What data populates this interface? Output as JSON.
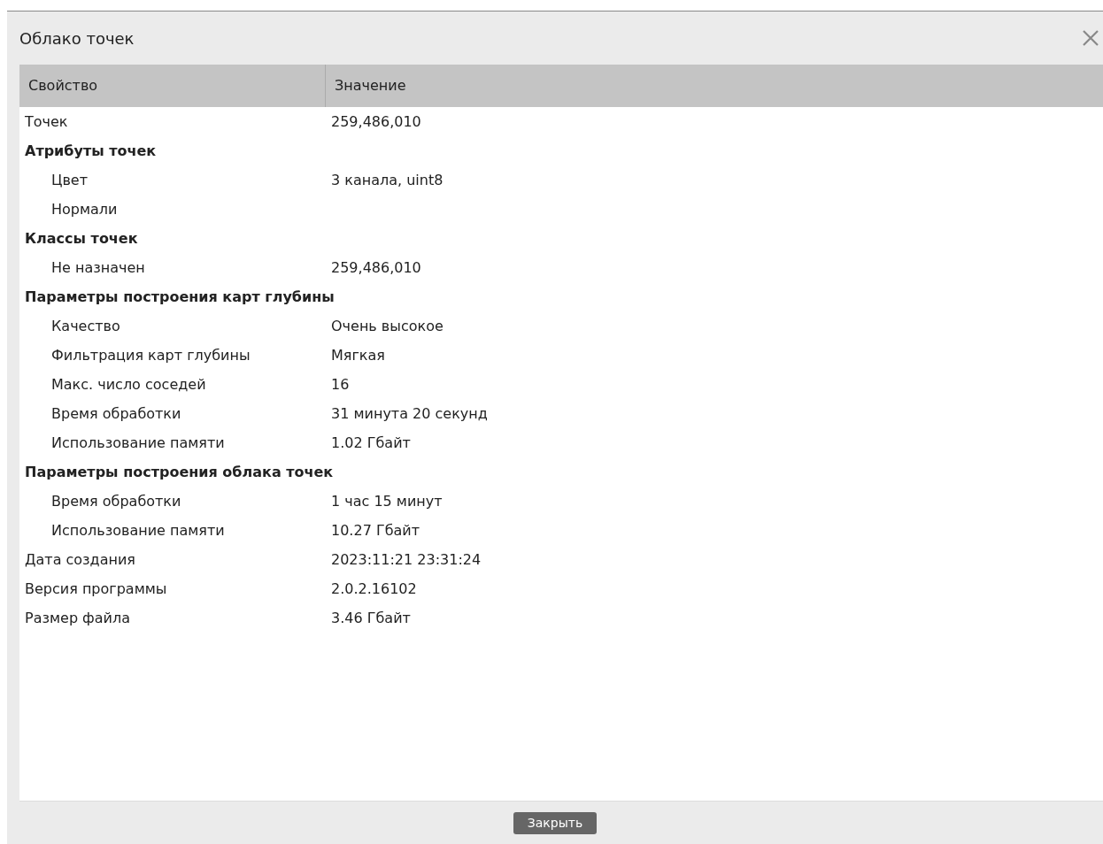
{
  "window": {
    "title": "Облако точек"
  },
  "table": {
    "columns": [
      "Свойство",
      "Значение"
    ],
    "rows": [
      {
        "kind": "property",
        "name": "Точек",
        "value": "259,486,010"
      },
      {
        "kind": "section",
        "name": "Атрибуты точек",
        "children": [
          {
            "kind": "property",
            "name": "Цвет",
            "value": "3 канала, uint8"
          },
          {
            "kind": "property",
            "name": "Нормали"
          }
        ]
      },
      {
        "kind": "section",
        "name": "Классы точек",
        "children": [
          {
            "kind": "property",
            "name": "Не назначен",
            "value": "259,486,010"
          }
        ]
      },
      {
        "kind": "section",
        "name": "Параметры построения карт глубины",
        "children": [
          {
            "kind": "property",
            "name": "Качество",
            "value": "Очень высокое"
          },
          {
            "kind": "property",
            "name": "Фильтрация карт глубины",
            "value": "Мягкая"
          },
          {
            "kind": "property",
            "name": "Макс. число соседей",
            "value": "16"
          },
          {
            "kind": "property",
            "name": "Время обработки",
            "value": "31 минута 20 секунд"
          },
          {
            "kind": "property",
            "name": "Использование памяти",
            "value": "1.02 Гбайт"
          }
        ]
      },
      {
        "kind": "section",
        "name": "Параметры построения облака точек",
        "children": [
          {
            "kind": "property",
            "name": "Время обработки",
            "value": "1 час 15 минут"
          },
          {
            "kind": "property",
            "name": "Использование памяти",
            "value": "10.27 Гбайт"
          }
        ]
      },
      {
        "kind": "property",
        "name": "Дата создания",
        "value": "2023:11:21 23:31:24"
      },
      {
        "kind": "property",
        "name": "Версия программы",
        "value": "2.0.2.16102"
      },
      {
        "kind": "property",
        "name": "Размер файла",
        "value": "3.46 Гбайт"
      }
    ]
  },
  "buttons": [
    "Закрыть"
  ]
}
